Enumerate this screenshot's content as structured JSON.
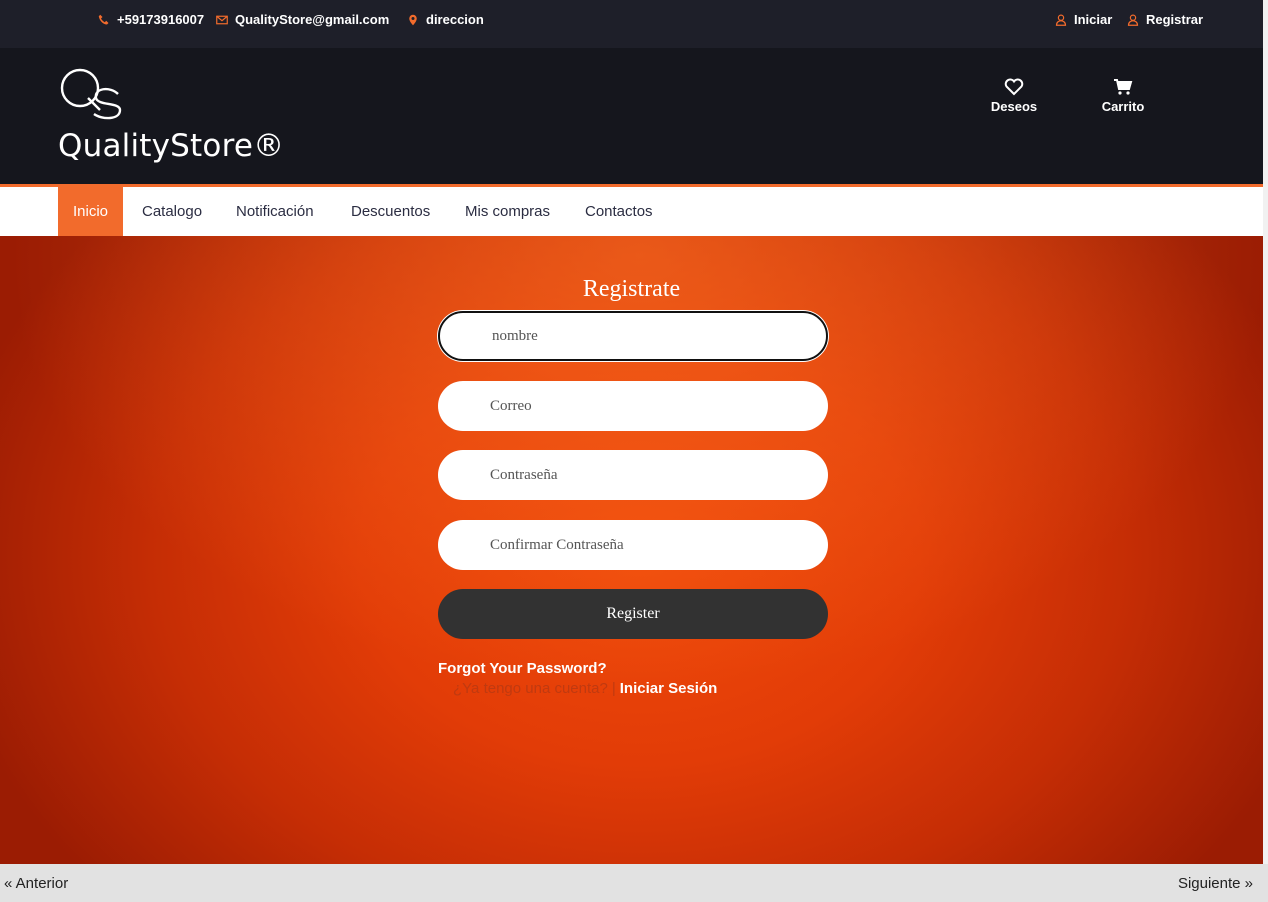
{
  "topbar": {
    "phone": "+59173916007",
    "email": "QualityStore@gmail.com",
    "address": "direccion",
    "login_label": "Iniciar",
    "register_label": "Registrar",
    "icon_color": "#f26b2c"
  },
  "header": {
    "logo_letters": "QS",
    "brand": "QualityStore®",
    "wishlist_label": "Deseos",
    "cart_label": "Carrito"
  },
  "nav": {
    "items": [
      {
        "label": "Inicio",
        "active": true
      },
      {
        "label": "Catalogo"
      },
      {
        "label": "Notificación"
      },
      {
        "label": "Descuentos"
      },
      {
        "label": "Mis compras"
      },
      {
        "label": "Contactos"
      }
    ],
    "accent": "#f26b2c"
  },
  "form": {
    "title": "Registrate",
    "name_placeholder": "nombre",
    "email_placeholder": "Correo",
    "password_placeholder": "Contraseña",
    "confirm_placeholder": "Confirmar Contraseña",
    "submit_label": "Register",
    "forgot_label": "Forgot Your Password?",
    "have_account_label": "¿Ya tengo una cuenta?",
    "separator": "|",
    "login_link_label": "Iniciar Sesión"
  },
  "pager": {
    "prev_label": "« Anterior",
    "next_label": "Siguiente »"
  }
}
